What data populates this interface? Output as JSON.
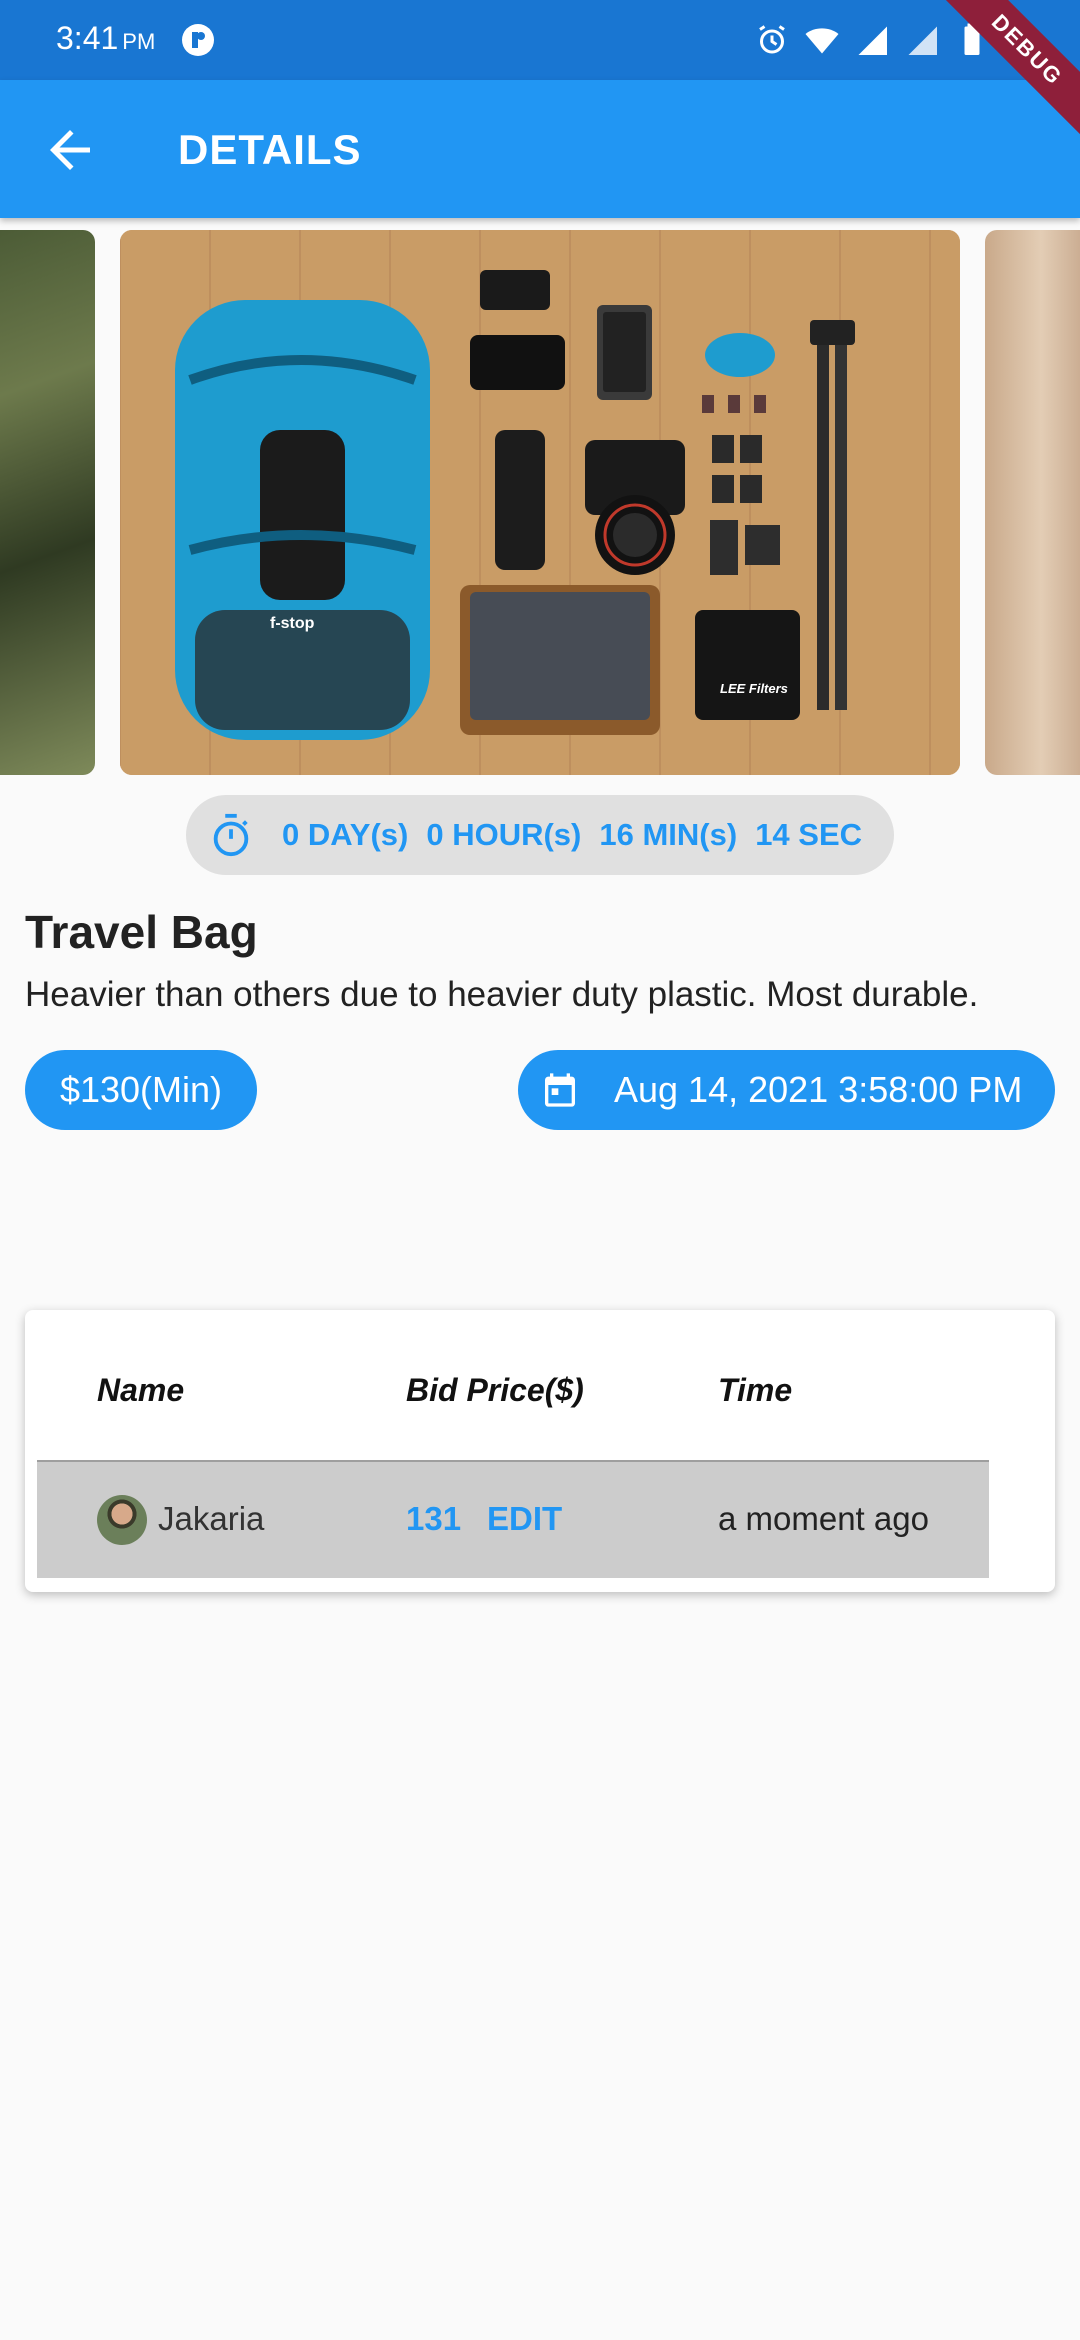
{
  "status_bar": {
    "time": "3:41",
    "ampm": "PM",
    "debug_label": "DEBUG"
  },
  "app_bar": {
    "title": "DETAILS"
  },
  "countdown": {
    "days": "0 DAY(s)",
    "hours": "0 HOUR(s)",
    "mins": "16 MIN(s)",
    "secs": "14 SEC"
  },
  "product": {
    "title": "Travel Bag",
    "description": "Heavier than others due to heavier duty plastic. Most durable.",
    "min_price": "$130(Min)",
    "end_date": "Aug 14, 2021 3:58:00 PM",
    "brand_text": "f-stop",
    "filter_text": "LEE Filters"
  },
  "bids_table": {
    "headers": {
      "name": "Name",
      "price": "Bid Price($)",
      "time": "Time"
    },
    "rows": [
      {
        "name": "Jakaria",
        "amount": "131",
        "action": "EDIT",
        "time": "a moment ago"
      }
    ]
  },
  "colors": {
    "primary": "#2196f3",
    "status_bar": "#1976d2",
    "debug_ribbon": "#8e1f3a"
  },
  "icons": [
    "back-arrow-icon",
    "timer-icon",
    "calendar-icon",
    "alarm-icon",
    "wifi-icon",
    "signal-icon",
    "battery-icon"
  ]
}
